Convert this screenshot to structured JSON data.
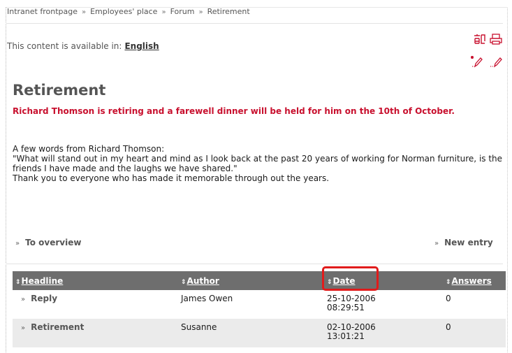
{
  "breadcrumb": {
    "items": [
      "Intranet frontpage",
      "Employees' place",
      "Forum",
      "Retirement"
    ],
    "separator": "»"
  },
  "language": {
    "label": "This content is available in:",
    "current": "English"
  },
  "toolbar": {
    "icons": [
      "translate-icon",
      "print-icon",
      "new-entry-pencil-icon",
      "edit-pencil-icon"
    ]
  },
  "article": {
    "title": "Retirement",
    "lead": "Richard Thomson is retiring and a farewell dinner will be held for him on the 10th of October.",
    "paragraphs": [
      "A few words from Richard Thomson:",
      "\"What will stand out in my heart and mind as I look back at the past 20 years of working for Norman furniture, is the friends I have made and the laughs we have shared.\"",
      "Thank you to everyone who has made it memorable through out the years."
    ]
  },
  "nav": {
    "overview": "To overview",
    "new_entry": "New entry",
    "arrow": "»"
  },
  "table": {
    "sort_glyph": "⇕",
    "columns": [
      "Headline",
      "Author",
      "Date",
      "Answers"
    ],
    "rows": [
      {
        "headline": "Reply",
        "author": "James Owen",
        "date": "25-10-2006",
        "time": "08:29:51",
        "answers": "0"
      },
      {
        "headline": "Retirement",
        "author": "Susanne",
        "date": "02-10-2006",
        "time": "13:01:21",
        "answers": "0"
      }
    ]
  },
  "colors": {
    "lead": "#c8102e",
    "table_header": "#6e6e6e",
    "highlight": "#e11b1b",
    "toolbar_icon": "#c8102e"
  }
}
